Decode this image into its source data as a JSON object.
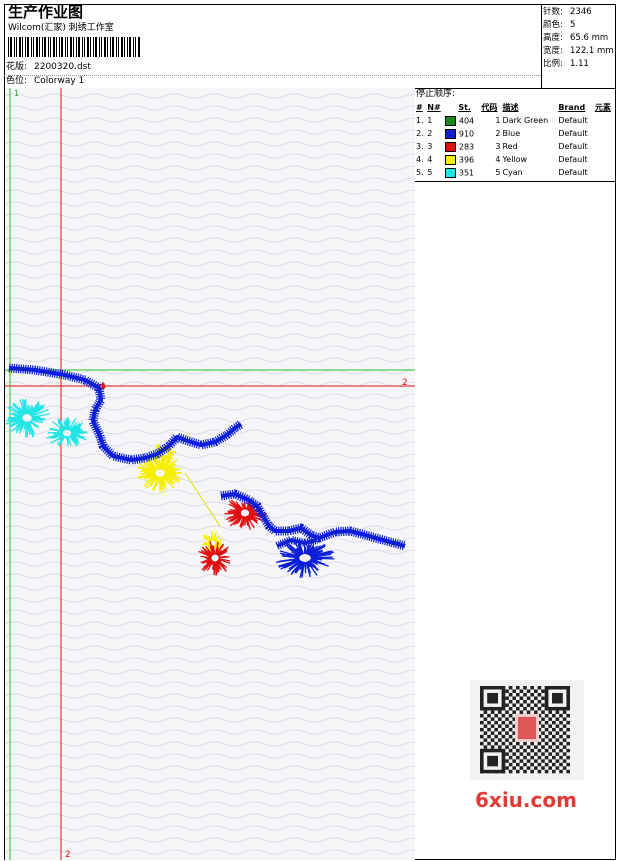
{
  "header": {
    "title": "生产作业图",
    "company": "Wilcom(汇家) 刺绣工作室",
    "design_label": "花版:",
    "design_file": "2200320.dst",
    "colorway_label": "色位:",
    "colorway": "Colorway 1"
  },
  "stats": {
    "stitches_label": "针数:",
    "stitches": "2346",
    "colors_label": "颜色:",
    "colors": "5",
    "height_label": "高度:",
    "height": "65.6 mm",
    "width_label": "宽度:",
    "width": "122.1 mm",
    "scale_label": "比例:",
    "scale": "1.11"
  },
  "stop_sequence": {
    "title": "停止顺序:",
    "headers": [
      "#",
      "N#",
      "St.",
      "代码",
      "描述",
      "Brand",
      "元素"
    ],
    "rows": [
      {
        "num": "1.",
        "n": "1",
        "color": "#1a8a1a",
        "st": "404",
        "code": "1",
        "desc": "Dark Green",
        "brand": "Default"
      },
      {
        "num": "2.",
        "n": "2",
        "color": "#0b1fd6",
        "st": "910",
        "code": "2",
        "desc": "Blue",
        "brand": "Default"
      },
      {
        "num": "3.",
        "n": "3",
        "color": "#e01010",
        "st": "283",
        "code": "3",
        "desc": "Red",
        "brand": "Default"
      },
      {
        "num": "4.",
        "n": "4",
        "color": "#f5f000",
        "st": "396",
        "code": "4",
        "desc": "Yellow",
        "brand": "Default"
      },
      {
        "num": "5.",
        "n": "5",
        "color": "#22e6e6",
        "st": "351",
        "code": "5",
        "desc": "Cyan",
        "brand": "Default"
      }
    ]
  },
  "guides": {
    "green_v": "1",
    "red_h": "2",
    "red_v": "2"
  },
  "watermark": "6xiu.com"
}
